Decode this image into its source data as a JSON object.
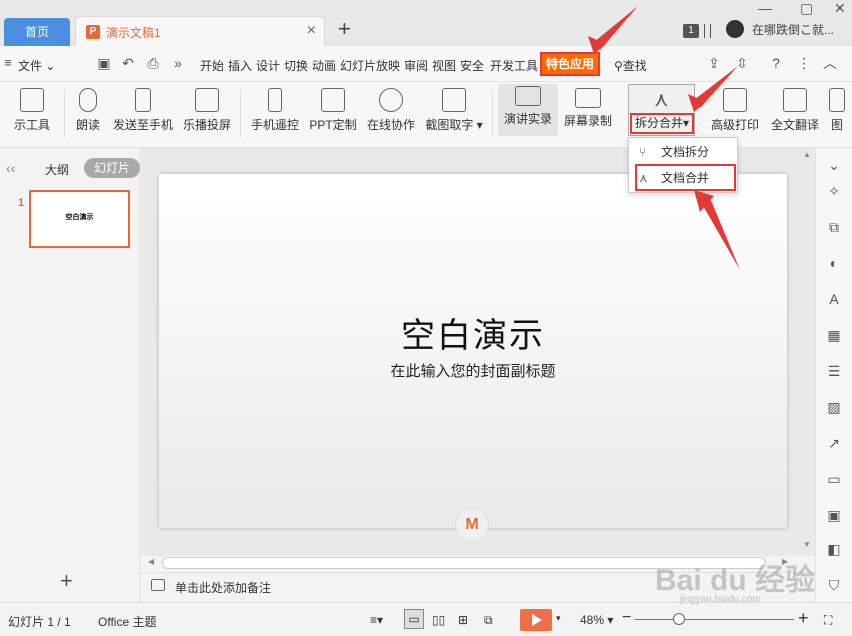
{
  "titlebar": {
    "home_tab": "首页",
    "doc_tab": "演示文稿1",
    "doc_icon": "P",
    "close_glyph": "×",
    "add_glyph": "+",
    "badge": "1",
    "username": "在哪跌倒こ就..."
  },
  "menubar": {
    "file": "文件",
    "tabs": [
      "开始",
      "插入",
      "设计",
      "切换",
      "动画",
      "幻灯片放映",
      "审阅",
      "视图",
      "安全",
      "开发工具"
    ],
    "special": "特色应用",
    "search": "查找",
    "help": "?"
  },
  "ribbon": {
    "items": [
      {
        "label": "示工具"
      },
      {
        "label": "朗读"
      },
      {
        "label": "发送至手机"
      },
      {
        "label": "乐播投屏"
      },
      {
        "label": "手机遥控"
      },
      {
        "label": "PPT定制"
      },
      {
        "label": "在线协作"
      },
      {
        "label": "截图取字"
      },
      {
        "label": "演讲实录"
      },
      {
        "label": "屏幕录制"
      },
      {
        "label": "拆分合并"
      },
      {
        "label": "高级打印"
      },
      {
        "label": "全文翻译"
      },
      {
        "label": "图"
      }
    ]
  },
  "dropdown": {
    "items": [
      "文档拆分",
      "文档合并"
    ]
  },
  "leftpanel": {
    "outline": "大纲",
    "slides": "幻灯片",
    "thumb_num": "1",
    "thumb_title": "空白演示",
    "add": "+"
  },
  "slide": {
    "title": "空白演示",
    "subtitle": "在此输入您的封面副标题"
  },
  "notes": {
    "placeholder": "单击此处添加备注"
  },
  "statusbar": {
    "slide_info": "幻灯片 1 / 1",
    "theme": "Office 主题",
    "zoom": "48%",
    "zoom_minus": "−",
    "zoom_plus": "+"
  },
  "watermark": {
    "text": "Bai du 经验",
    "url": "jingyan.baidu.com"
  },
  "colors": {
    "accent": "#e8683a",
    "home_tab": "#4a90e2",
    "highlight": "#ff6a00",
    "annotation": "#e53935"
  }
}
